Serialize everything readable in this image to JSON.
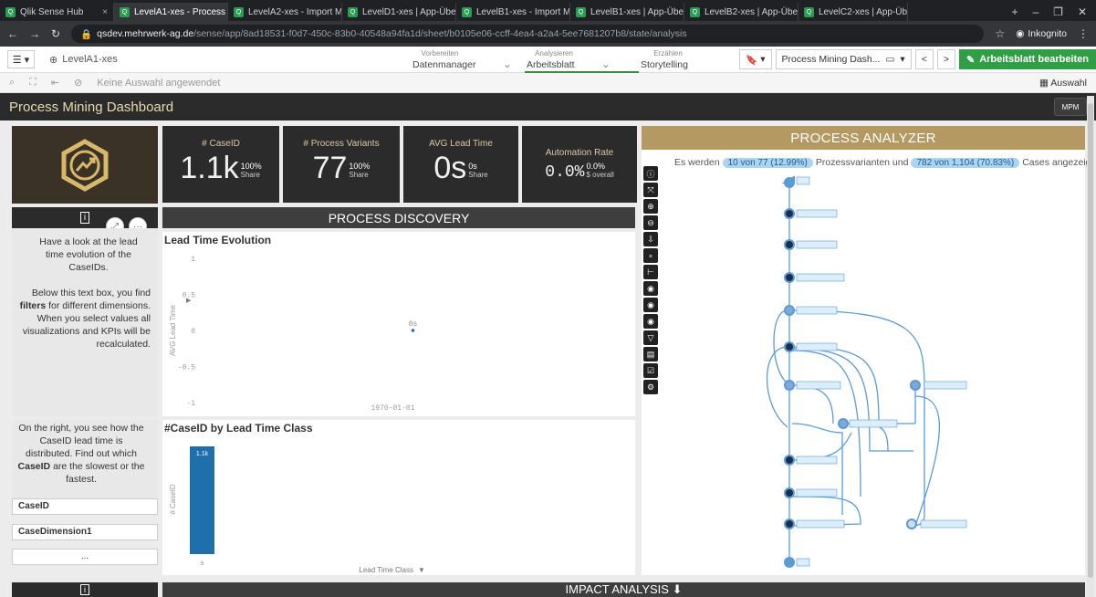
{
  "browser": {
    "tabs": [
      {
        "label": "Qlik Sense Hub",
        "active": false
      },
      {
        "label": "LevelA1-xes - Process Mini",
        "active": true
      },
      {
        "label": "LevelA2-xes - Import Mast",
        "active": false
      },
      {
        "label": "LevelD1-xes | App-Übersic",
        "active": false
      },
      {
        "label": "LevelB1-xes - Import Mast",
        "active": false
      },
      {
        "label": "LevelB1-xes | App-Übersic",
        "active": false
      },
      {
        "label": "LevelB2-xes | App-Übersic",
        "active": false
      },
      {
        "label": "LevelC2-xes | App-Übersic",
        "active": false
      }
    ],
    "url_host": "qsdev.mehrwerk-ag.de",
    "url_path": "/sense/app/8ad18531-f0d7-450c-83b0-40548a94fa1d/sheet/b0105e06-ccff-4ea4-a2a4-5ee7681207b8/state/analysis",
    "incognito": "Inkognito"
  },
  "qlik": {
    "app_name": "LevelA1-xes",
    "modes": [
      {
        "sub": "Vorbereiten",
        "main": "Datenmanager"
      },
      {
        "sub": "Analysieren",
        "main": "Arbeitsblatt"
      },
      {
        "sub": "Erzählen",
        "main": "Storytelling"
      }
    ],
    "sheet_selector": "Process Mining Dash...",
    "edit_button": "Arbeitsblatt bearbeiten",
    "no_selection": "Keine Auswahl angewendet",
    "auswahl": "Auswahl",
    "sheet_title": "Process Mining Dashboard",
    "mpm": "MPM"
  },
  "kpis": [
    {
      "label": "# CaseID",
      "value": "1.1k",
      "pct": "100%",
      "sub": "Share"
    },
    {
      "label": "# Process Variants",
      "value": "77",
      "pct": "100%",
      "sub": "Share"
    },
    {
      "label": "AVG Lead Time",
      "value": "0s",
      "pct": "0s",
      "sub": "Share"
    },
    {
      "label": "Automation Rate",
      "value": "0.0%",
      "pct": "0.0%",
      "sub": "$ overall"
    }
  ],
  "info": {
    "text1_a": "Have a look at the lead time evolution of the CaseIDs.",
    "text1_b": "Below this text box, you find",
    "text1_bold": "filters",
    "text1_c": "for different dimensions. When you select values all visualizations and KPIs will be recalculated.",
    "text2_a": "On the right, you see how the CaseID lead time is distributed. Find out which",
    "text2_bold": "CaseID",
    "text2_c": "are the slowest or the fastest.",
    "filter1": "CaseID",
    "filter2": "CaseDimension1",
    "more": "..."
  },
  "discovery": {
    "title": "PROCESS DISCOVERY",
    "chart1_title": "Lead Time Evolution",
    "chart2_title": "#CaseID by Lead Time Class"
  },
  "analyzer": {
    "title": "PROCESS ANALYZER",
    "text_pre": "Es werden",
    "pill1": "10 von 77 (12.99%)",
    "text_mid": "Prozessvarianten und",
    "pill2": "782 von 1,104 (70.83%)",
    "text_post": "Cases angezeigt"
  },
  "impact": {
    "title": "IMPACT ANALYSIS ⬇"
  },
  "chart_data": [
    {
      "type": "scatter",
      "title": "Lead Time Evolution",
      "xlabel": "",
      "ylabel": "AVG Lead Time",
      "x": [
        "1970-01-01"
      ],
      "y": [
        0
      ],
      "point_labels": [
        "0s"
      ],
      "yticks": [
        "1",
        "0.5",
        "0",
        "-0.5",
        "-1"
      ],
      "ylim": [
        -1,
        1
      ]
    },
    {
      "type": "bar",
      "title": "#CaseID by Lead Time Class",
      "xlabel": "Lead Time Class",
      "ylabel": "# CaseID",
      "categories": [
        "s"
      ],
      "values": [
        1104
      ],
      "data_labels": [
        "1.1k"
      ],
      "color": "#1f6fad"
    }
  ]
}
